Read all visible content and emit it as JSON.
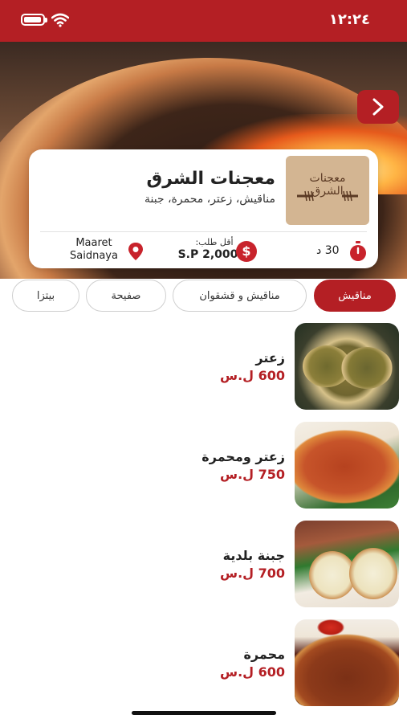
{
  "status_bar": {
    "time": "١٢:٢٤"
  },
  "restaurant": {
    "name": "معجنات الشرق",
    "tags": "مناقيش، زعتر، محمرة، جبنة",
    "logo_text_line1": "معجنات",
    "logo_text_line2": "الشرق",
    "location": "Maaret Saidnaya",
    "min_order_label": "أقل طلب:",
    "min_order_value": "S.P 2,000",
    "delivery_time": "30 د"
  },
  "tabs": [
    {
      "label": "مناقيش",
      "active": true
    },
    {
      "label": "مناقيش و قشقوان",
      "active": false
    },
    {
      "label": "صفيحة",
      "active": false
    },
    {
      "label": "بيتزا",
      "active": false
    }
  ],
  "menu_items": [
    {
      "name": "زعتر",
      "price": "600 ل.س"
    },
    {
      "name": "زعتر ومحمرة",
      "price": "750 ل.س"
    },
    {
      "name": "جبنة بلدية",
      "price": "700 ل.س"
    },
    {
      "name": "محمرة",
      "price": "600 ل.س"
    }
  ],
  "colors": {
    "brand_red": "#b41f24",
    "logo_beige": "#d3b592"
  },
  "icons": [
    "battery-icon",
    "wifi-icon",
    "chevron-right-icon",
    "location-pin-icon",
    "dollar-icon",
    "timer-icon"
  ]
}
